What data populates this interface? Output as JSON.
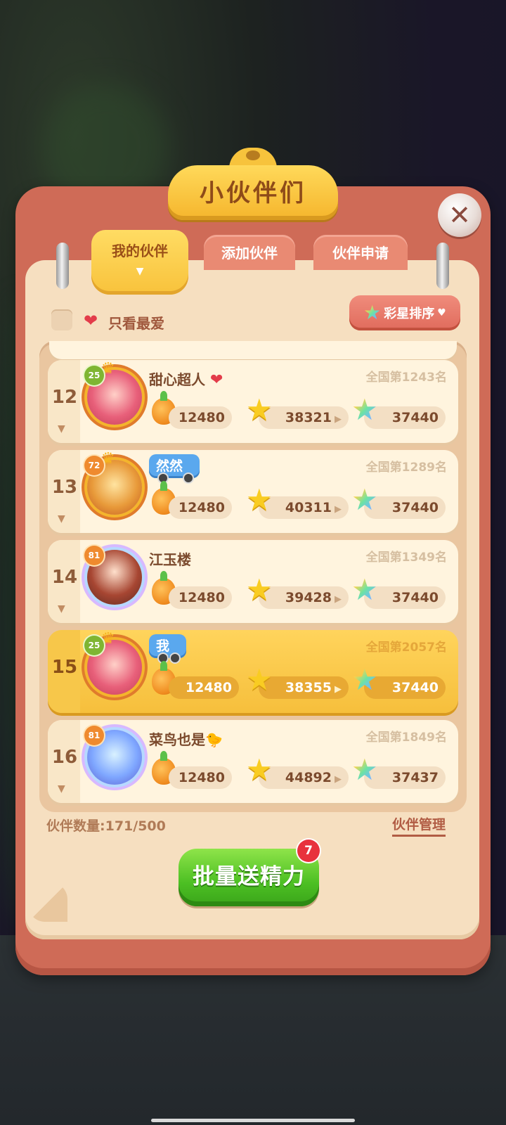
{
  "title": "小伙伴们",
  "close_icon": "close-icon",
  "tabs": {
    "active": "我的伙伴",
    "add": "添加伙伴",
    "requests": "伙伴申请"
  },
  "filter": {
    "favorites_only_label": "只看最爱",
    "checked": false
  },
  "sort_button_label": "彩星排序",
  "friends": [
    {
      "rank": "12",
      "name": "甜心超人",
      "level": "25",
      "national_rank": "全国第1243名",
      "energy": "12480",
      "stars": "38321",
      "rainbow_stars": "37440",
      "name_style": "heart"
    },
    {
      "rank": "13",
      "name": "然然",
      "level": "72",
      "national_rank": "全国第1289名",
      "energy": "12480",
      "stars": "40311",
      "rainbow_stars": "37440",
      "name_style": "tag"
    },
    {
      "rank": "14",
      "name": "江玉楼",
      "level": "81",
      "national_rank": "全国第1349名",
      "energy": "12480",
      "stars": "39428",
      "rainbow_stars": "37440",
      "name_style": "plain"
    },
    {
      "rank": "15",
      "name": "我",
      "level": "25",
      "national_rank": "全国第2057名",
      "energy": "12480",
      "stars": "38355",
      "rainbow_stars": "37440",
      "name_style": "tag",
      "is_me": true
    },
    {
      "rank": "16",
      "name": "菜鸟也是",
      "level": "81",
      "national_rank": "全国第1849名",
      "energy": "12480",
      "stars": "44892",
      "rainbow_stars": "37437",
      "name_style": "bird"
    }
  ],
  "friend_count_label": "伙伴数量:171/500",
  "manage_label": "伙伴管理",
  "send_energy_button": "批量送精力",
  "send_badge_count": "7"
}
